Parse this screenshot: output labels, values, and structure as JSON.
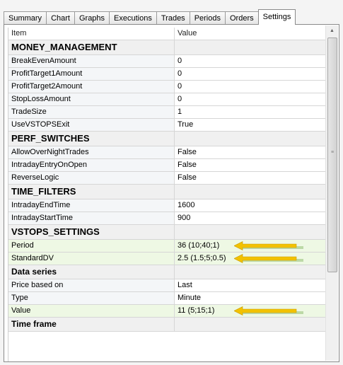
{
  "tabs": [
    {
      "label": "Summary"
    },
    {
      "label": "Chart"
    },
    {
      "label": "Graphs"
    },
    {
      "label": "Executions"
    },
    {
      "label": "Trades"
    },
    {
      "label": "Periods"
    },
    {
      "label": "Orders"
    },
    {
      "label": "Settings",
      "active": true
    }
  ],
  "grid": {
    "header": {
      "item": "Item",
      "value": "Value"
    },
    "rows": [
      {
        "kind": "cat",
        "item": "MONEY_MANAGEMENT",
        "value": ""
      },
      {
        "kind": "prop",
        "item": "BreakEvenAmount",
        "value": "0"
      },
      {
        "kind": "prop",
        "item": "ProfitTarget1Amount",
        "value": "0"
      },
      {
        "kind": "prop",
        "item": "ProfitTarget2Amount",
        "value": "0"
      },
      {
        "kind": "prop",
        "item": "StopLossAmount",
        "value": "0"
      },
      {
        "kind": "prop",
        "item": "TradeSize",
        "value": "1"
      },
      {
        "kind": "prop",
        "item": "UseVSTOPSExit",
        "value": "True"
      },
      {
        "kind": "cat",
        "item": "PERF_SWITCHES",
        "value": ""
      },
      {
        "kind": "prop",
        "item": "AllowOverNightTrades",
        "value": "False"
      },
      {
        "kind": "prop",
        "item": "IntradayEntryOnOpen",
        "value": "False"
      },
      {
        "kind": "prop",
        "item": "ReverseLogic",
        "value": "False"
      },
      {
        "kind": "cat",
        "item": "TIME_FILTERS",
        "value": ""
      },
      {
        "kind": "prop",
        "item": "IntradayEndTime",
        "value": "1600"
      },
      {
        "kind": "prop",
        "item": "IntradayStartTime",
        "value": "900"
      },
      {
        "kind": "cat",
        "item": "VSTOPS_SETTINGS",
        "value": ""
      },
      {
        "kind": "prop",
        "item": "Period",
        "value": "36 (10;40;1)",
        "highlight": true
      },
      {
        "kind": "prop",
        "item": "StandardDV",
        "value": "2.5 (1.5;5;0.5)",
        "highlight": true
      },
      {
        "kind": "sub",
        "item": "Data series",
        "value": ""
      },
      {
        "kind": "prop",
        "item": "Price based on",
        "value": "Last"
      },
      {
        "kind": "prop",
        "item": "Type",
        "value": "Minute"
      },
      {
        "kind": "prop",
        "item": "Value",
        "value": "11 (5;15;1)",
        "highlight": true
      },
      {
        "kind": "sub",
        "item": "Time frame",
        "value": ""
      }
    ]
  },
  "colors": {
    "arrow_fill": "#f2c200",
    "arrow_trail": "#bcd9a6",
    "highlight_row": "#eef8e4"
  },
  "icons": {
    "scroll_up": "triangle-up",
    "scroll_grip": "grip-lines"
  }
}
